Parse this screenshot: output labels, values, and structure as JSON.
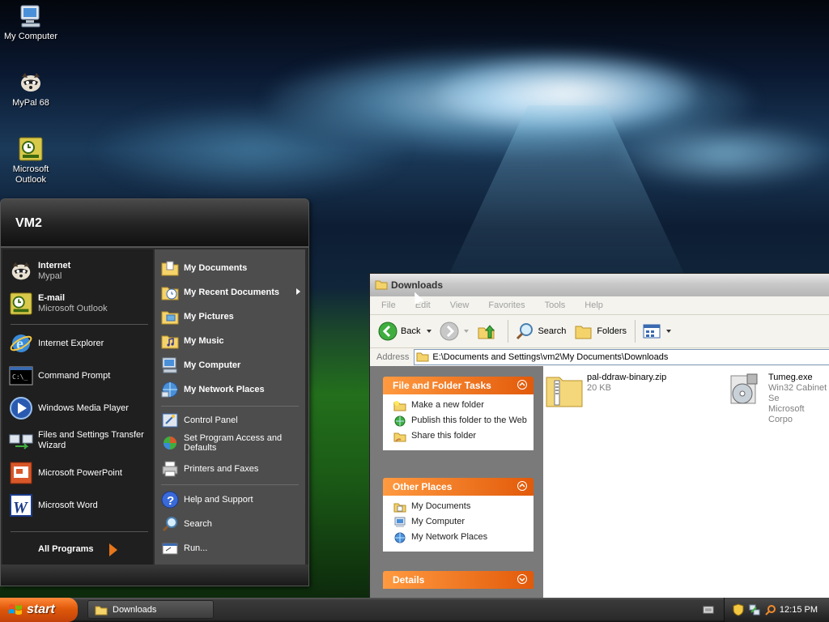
{
  "desktop": {
    "icons": [
      {
        "label": "My Computer",
        "icon": "computer-icon"
      },
      {
        "label": "MyPal 68",
        "icon": "raccoon-icon"
      },
      {
        "label": "Microsoft Outlook",
        "icon": "outlook-icon"
      }
    ]
  },
  "start_menu": {
    "user": "VM2",
    "pinned": [
      {
        "title": "Internet",
        "subtitle": "Mypal",
        "icon": "raccoon-icon"
      },
      {
        "title": "E-mail",
        "subtitle": "Microsoft Outlook",
        "icon": "outlook-icon"
      }
    ],
    "recent": [
      {
        "label": "Internet Explorer",
        "icon": "ie-icon"
      },
      {
        "label": "Command Prompt",
        "icon": "cmd-icon"
      },
      {
        "label": "Windows Media Player",
        "icon": "media-player-icon"
      },
      {
        "label": "Files and Settings Transfer Wizard",
        "icon": "transfer-wizard-icon"
      },
      {
        "label": "Microsoft PowerPoint",
        "icon": "powerpoint-icon"
      },
      {
        "label": "Microsoft Word",
        "icon": "word-icon"
      }
    ],
    "all_programs": "All Programs",
    "places": [
      {
        "label": "My Documents",
        "icon": "documents-folder-icon"
      },
      {
        "label": "My Recent Documents",
        "icon": "recent-documents-icon"
      },
      {
        "label": "My Pictures",
        "icon": "pictures-folder-icon"
      },
      {
        "label": "My Music",
        "icon": "music-folder-icon"
      },
      {
        "label": "My Computer",
        "icon": "computer-icon"
      },
      {
        "label": "My Network Places",
        "icon": "network-icon"
      }
    ],
    "system": [
      {
        "label": "Control Panel",
        "icon": "control-panel-icon"
      },
      {
        "label": "Set Program Access and Defaults",
        "icon": "program-defaults-icon"
      },
      {
        "label": "Printers and Faxes",
        "icon": "printer-icon"
      }
    ],
    "help": [
      {
        "label": "Help and Support",
        "icon": "help-icon"
      },
      {
        "label": "Search",
        "icon": "search-icon"
      },
      {
        "label": "Run...",
        "icon": "run-icon"
      }
    ]
  },
  "explorer": {
    "title": "Downloads",
    "menu": [
      "File",
      "Edit",
      "View",
      "Favorites",
      "Tools",
      "Help"
    ],
    "toolbar": {
      "back": "Back",
      "search": "Search",
      "folders": "Folders"
    },
    "address_label": "Address",
    "address": "E:\\Documents and Settings\\vm2\\My Documents\\Downloads",
    "panels": {
      "tasks": {
        "title": "File and Folder Tasks",
        "links": [
          {
            "label": "Make a new folder",
            "icon": "new-folder-icon"
          },
          {
            "label": "Publish this folder to the Web",
            "icon": "publish-web-icon"
          },
          {
            "label": "Share this folder",
            "icon": "share-folder-icon"
          }
        ]
      },
      "other": {
        "title": "Other Places",
        "links": [
          {
            "label": "My Documents",
            "icon": "documents-folder-icon"
          },
          {
            "label": "My Computer",
            "icon": "computer-icon"
          },
          {
            "label": "My Network Places",
            "icon": "network-icon"
          }
        ]
      },
      "details": {
        "title": "Details"
      }
    },
    "files": [
      {
        "name": "pal-ddraw-binary.zip",
        "info1": "20 KB",
        "info2": "",
        "icon": "zip-folder-icon"
      },
      {
        "name": "Tumeg.exe",
        "info1": "Win32 Cabinet Se",
        "info2": "Microsoft Corpo",
        "icon": "installer-icon"
      }
    ]
  },
  "taskbar": {
    "start": "start",
    "window_button": "Downloads",
    "clock": "12:15 PM"
  },
  "colors": {
    "accent": "#e25a0a",
    "taskpane": "#7a7a7a",
    "startmenu": "#2b2b2b"
  }
}
